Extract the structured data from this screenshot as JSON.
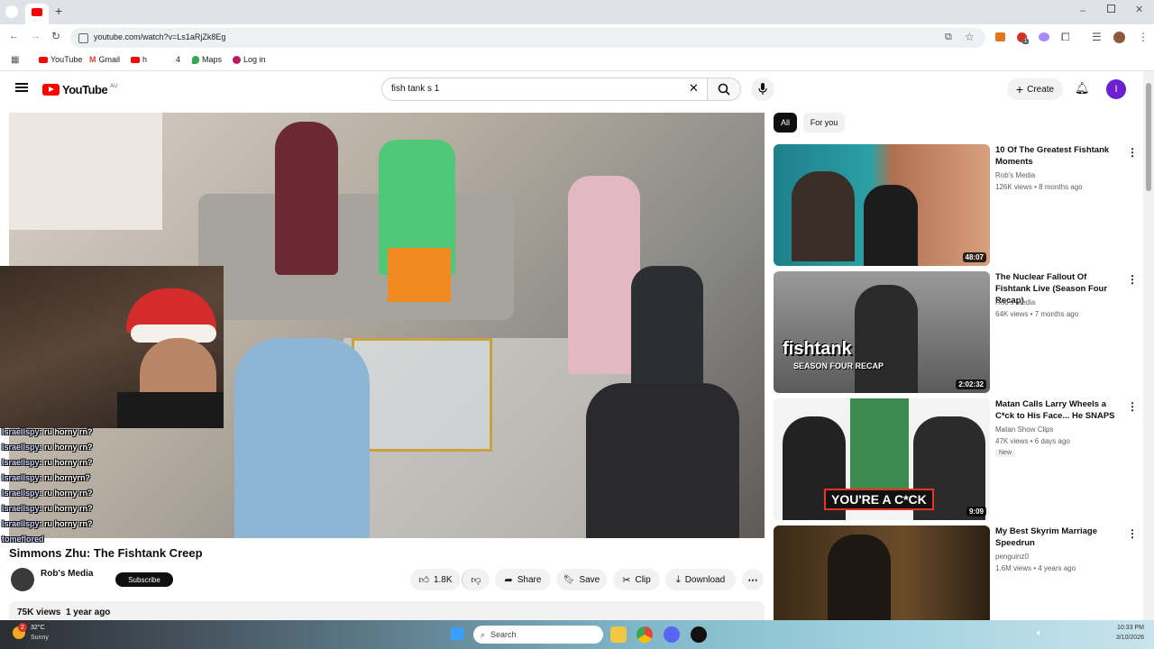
{
  "browser": {
    "address": "youtube.com/watch?v=Ls1aRjZk8Eg",
    "bookmarks": [
      "YouTube",
      "Gmail",
      "h",
      "4",
      "Maps",
      "Log in"
    ],
    "badge_count": "1"
  },
  "header": {
    "logo_text": "YouTube",
    "logo_sup": "AU",
    "search_value": "fish tank s 1",
    "create_label": "Create",
    "avatar_letter": "I"
  },
  "chat": [
    {
      "user": "IsraelIspy",
      "msg": ": ru horny rn?"
    },
    {
      "user": "IsraelIspy",
      "msg": ": ru horny rn?"
    },
    {
      "user": "IsraelIspy",
      "msg": ": ru horny rn?"
    },
    {
      "user": "IsraelIspy",
      "msg": ": ru hornyrn?"
    },
    {
      "user": "IsraelIspy",
      "msg": ": ru horny rn?"
    },
    {
      "user": "IsraelIspy",
      "msg": ": ru horny rn?"
    },
    {
      "user": "IsraelIspy",
      "msg": ": ru horny rn?"
    },
    {
      "user": "tomeflored",
      "msg": ""
    }
  ],
  "video": {
    "title": "Simmons Zhu: The Fishtank Creep",
    "channel": "Rob's Media",
    "subscribe_label": "Subscribe",
    "likes": "1.8K",
    "share_label": "Share",
    "save_label": "Save",
    "clip_label": "Clip",
    "download_label": "Download",
    "views": "75K views",
    "age": "1 year ago"
  },
  "chips": [
    "All",
    "For you"
  ],
  "recommendations": [
    {
      "title": "10 Of The Greatest Fishtank Moments",
      "channel": "Rob's Media",
      "meta": "126K views • 8 months ago",
      "duration": "48:07",
      "badge": ""
    },
    {
      "title": "The Nuclear Fallout Of Fishtank Live (Season Four Recap)",
      "channel": "Rob's Media",
      "meta": "64K views • 7 months ago",
      "duration": "2:02:32",
      "badge": ""
    },
    {
      "title": "Matan Calls Larry Wheels a C*ck to His Face... He SNAPS",
      "channel": "Matan Show Clips",
      "meta": "47K views • 6 days ago",
      "duration": "9:09",
      "badge": "New"
    },
    {
      "title": "My Best Skyrim Marriage Speedrun",
      "channel": "penguinz0",
      "meta": "1.6M views • 4 years ago",
      "duration": "",
      "badge": ""
    }
  ],
  "thumb_text": {
    "fishtank": "fishtank",
    "season_four": "SEASON FOUR RECAP",
    "youre": "YOU'RE A C*CK"
  },
  "taskbar": {
    "weather_temp": "32°C",
    "weather_desc": "Sunny",
    "search_label": "Search",
    "time": "10:33 PM",
    "date": "3/10/2026",
    "notif_count": "2"
  }
}
